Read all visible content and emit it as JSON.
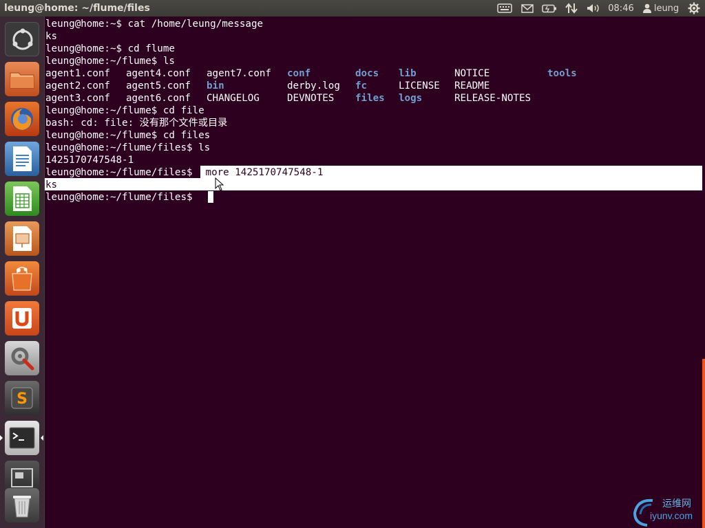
{
  "window": {
    "title": "leung@home: ~/flume/files"
  },
  "top_panel": {
    "time": "08:46",
    "user": "leung",
    "indicators": [
      "keyboard-icon",
      "mail-icon",
      "battery-icon",
      "network-icon",
      "volume-icon"
    ]
  },
  "launcher": {
    "items": [
      "dash-home",
      "files",
      "firefox",
      "libreoffice-writer",
      "libreoffice-calc",
      "libreoffice-impress",
      "ubuntu-software-center",
      "ubuntu-one",
      "system-settings",
      "sublime-text",
      "terminal",
      "workspace-switcher",
      "trash"
    ],
    "active": "terminal"
  },
  "terminal": {
    "lines": {
      "l1": "leung@home:~$ cat /home/leung/message",
      "l2": "ks",
      "l3": "leung@home:~$ cd flume",
      "l4": "leung@home:~/flume$ ls",
      "l8": "leung@home:~/flume$ cd file",
      "l9": "bash: cd: file: 没有那个文件或目录",
      "l10": "leung@home:~/flume$ cd files",
      "l11": "leung@home:~/flume/files$ ls",
      "l12": "1425170747548-1",
      "l13_prompt": "leung@home:~/flume/files$",
      "l13_cmd": " more 1425170747548-1",
      "l14": "ks",
      "l15": "leung@home:~/flume/files$ "
    },
    "ls_output": {
      "row1": [
        "agent1.conf",
        "agent4.conf",
        "agent7.conf",
        "conf",
        "docs",
        "lib",
        "NOTICE",
        "tools"
      ],
      "row2": [
        "agent2.conf",
        "agent5.conf",
        "bin",
        "derby.log",
        "fc",
        "LICENSE",
        "README"
      ],
      "row3": [
        "agent3.conf",
        "agent6.conf",
        "CHANGELOG",
        "DEVNOTES",
        "files",
        "logs",
        "RELEASE-NOTES"
      ]
    }
  },
  "watermark": {
    "cn": "运维网",
    "url": "iyunv.com"
  },
  "colors": {
    "background": "#2c001e",
    "directory": "#729fcf",
    "text": "#ffffff",
    "accent": "#e95420"
  }
}
